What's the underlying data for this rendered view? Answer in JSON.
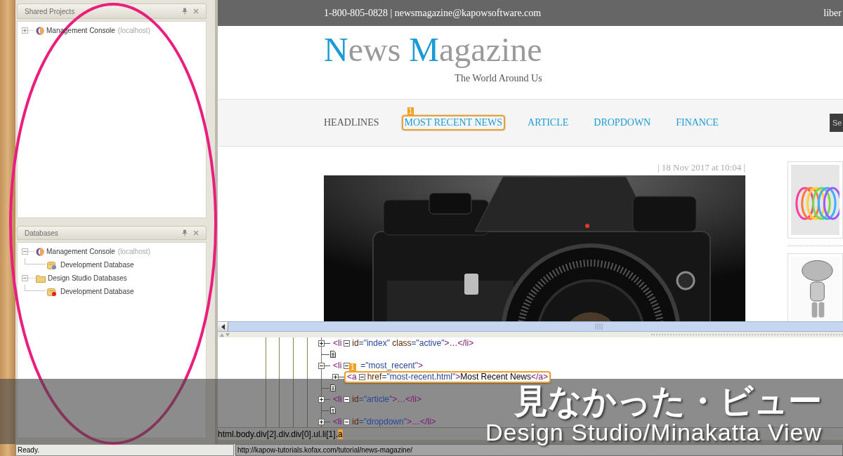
{
  "panels": [
    {
      "title": "Shared Projects",
      "items": [
        {
          "kind": "console",
          "label": "Management Console",
          "host": "(localhost)",
          "expanded": false
        }
      ]
    },
    {
      "title": "Databases",
      "items": [
        {
          "kind": "console",
          "label": "Management Console",
          "host": "(localhost)",
          "expanded": true,
          "children": [
            {
              "kind": "database",
              "label": "Development Database",
              "color": "#6d8fbf"
            }
          ]
        },
        {
          "kind": "folder",
          "label": "Design Studio Databases",
          "expanded": true,
          "children": [
            {
              "kind": "database",
              "label": "Development Database",
              "color": "#e0261b"
            }
          ]
        }
      ]
    }
  ],
  "browser": {
    "top_bar": {
      "contact": "1-800-805-0828 | newsmagazine@kapowsoftware.com",
      "right_text": "liber"
    },
    "logo": {
      "words": [
        {
          "initial": "N",
          "rest": "ews"
        },
        {
          "initial": "M",
          "rest": "agazine"
        }
      ]
    },
    "tagline": "The World Around Us",
    "nav": {
      "items": [
        {
          "label": "HEADLINES",
          "selected": true,
          "highlighted": false
        },
        {
          "label": "MOST RECENT NEWS",
          "selected": false,
          "highlighted": true,
          "marker": "1"
        },
        {
          "label": "ARTICLE",
          "selected": false,
          "highlighted": false
        },
        {
          "label": "DROPDOWN",
          "selected": false,
          "highlighted": false
        },
        {
          "label": "FINANCE",
          "selected": false,
          "highlighted": false
        }
      ],
      "search": {
        "placeholder": "Se"
      }
    },
    "article": {
      "date": "| 18 Nov 2017 at 10:04 |"
    }
  },
  "dom_tree": {
    "rows": [
      {
        "kind": "element",
        "expanded": false,
        "highlighted": false,
        "tag": "<li",
        "attrs": [
          {
            "name": "id",
            "value": "=\"index\""
          },
          {
            "name": "class",
            "value": "=\"active\""
          }
        ],
        "content": [
          {
            "kind": "markup",
            "text": ">…</li>"
          }
        ]
      },
      {
        "kind": "text_node"
      },
      {
        "kind": "element",
        "expanded": true,
        "highlighted": false,
        "tag": "<li",
        "attrs": [
          {
            "value": "=\"most_recent\""
          }
        ],
        "content": [
          {
            "kind": "markup",
            "text": ">"
          }
        ],
        "children": [
          {
            "kind": "element",
            "expanded": false,
            "highlighted": true,
            "marker": "1",
            "tag": "<a",
            "attrs": [
              {
                "name": "href",
                "value": "=\"most-recent.html\""
              }
            ],
            "content": [
              {
                "kind": "markup",
                "text": ">"
              },
              {
                "kind": "text",
                "text": "Most Recent News"
              },
              {
                "kind": "markup",
                "text": "</a>"
              }
            ]
          }
        ]
      },
      {
        "kind": "text_node"
      },
      {
        "kind": "element",
        "expanded": false,
        "highlighted": false,
        "tag": "<li",
        "attrs": [
          {
            "name": "id",
            "value": "=\"article\""
          }
        ],
        "content": [
          {
            "kind": "markup",
            "text": ">…</li>"
          }
        ]
      },
      {
        "kind": "text_node"
      },
      {
        "kind": "element",
        "expanded": false,
        "highlighted": false,
        "tag": "<li",
        "attrs": [
          {
            "name": "id",
            "value": "=\"dropdown\""
          }
        ],
        "content": [
          {
            "kind": "markup",
            "text": ">…</li>"
          }
        ]
      }
    ]
  },
  "path_bar": {
    "path": "html.body.div[2].div.div[0].ul.li[1].",
    "current": "a"
  },
  "status_bar": {
    "message": "Ready.",
    "url": "http://kapow-tutorials.kofax.com/tutorial/news-magazine/"
  },
  "banner": {
    "title": "見なかった・ビュー",
    "subtitle": "Design Studio/Minakatta View"
  }
}
